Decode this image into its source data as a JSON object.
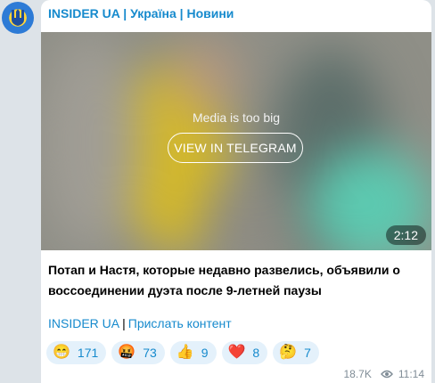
{
  "channel": {
    "name": "INSIDER UA | Україна | Новини",
    "avatar": "ukraine-trident-emblem"
  },
  "media": {
    "notice": "Media is too big",
    "button_label": "VIEW IN TELEGRAM",
    "duration": "2:12"
  },
  "message": {
    "text": "Потап и Настя, которые недавно развелись, объявили о воссоединении дуэта после 9-летней паузы"
  },
  "footer_links": {
    "channel_link": "INSIDER UA",
    "separator": "|",
    "submit_link": "Прислать контент"
  },
  "reactions": [
    {
      "emoji": "😁",
      "count": "171"
    },
    {
      "emoji": "🤬",
      "count": "73"
    },
    {
      "emoji": "👍",
      "count": "9"
    },
    {
      "emoji": "❤️",
      "count": "8"
    },
    {
      "emoji": "🤔",
      "count": "7"
    }
  ],
  "meta": {
    "views": "18.7K",
    "time": "11:14"
  },
  "colors": {
    "accent": "#168acd",
    "reaction_bg": "#e4f1fb",
    "background": "#dde3e8"
  }
}
